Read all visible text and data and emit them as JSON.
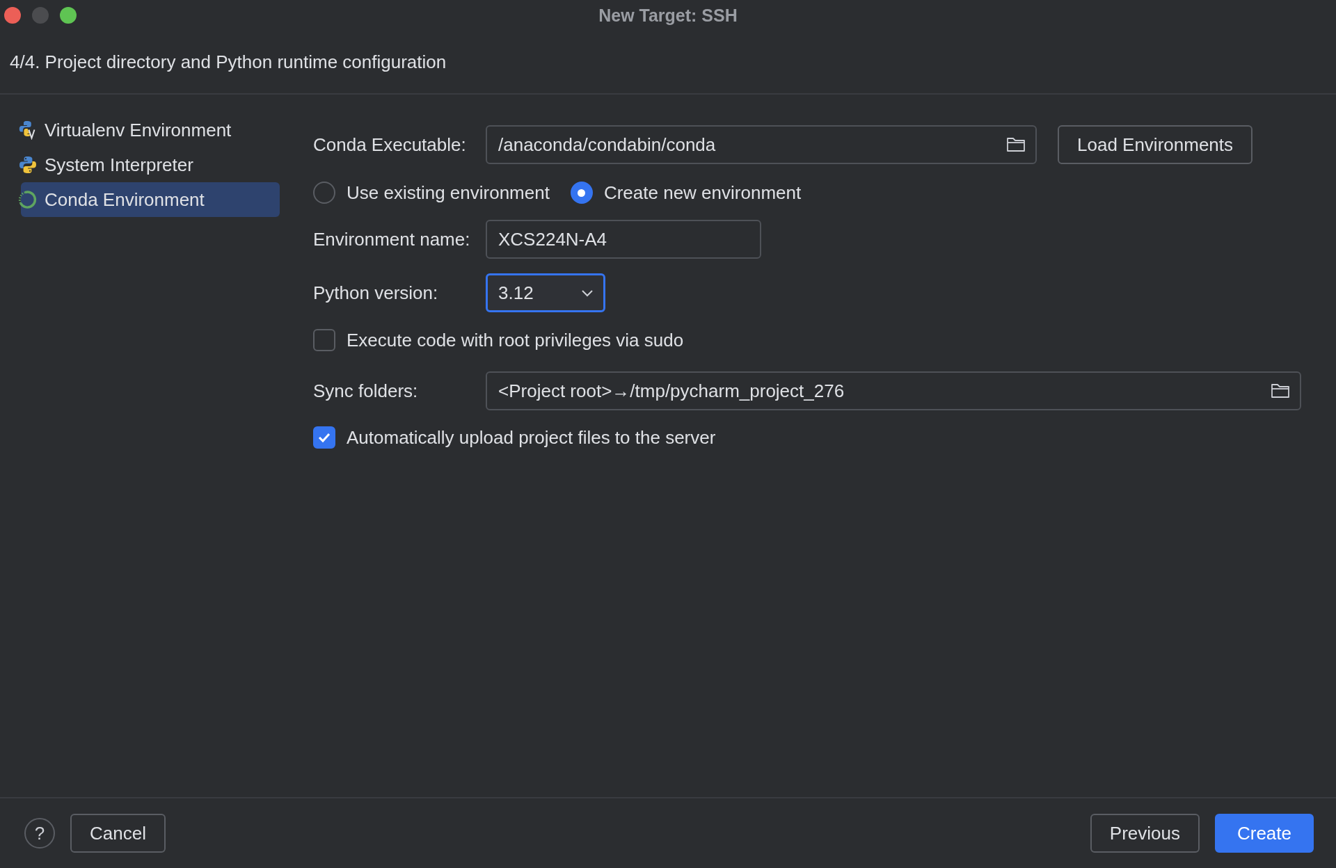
{
  "window": {
    "title": "New Target: SSH"
  },
  "step_title": "4/4. Project directory and Python runtime configuration",
  "sidebar": {
    "items": [
      {
        "label": "Virtualenv Environment",
        "kind": "virtualenv",
        "selected": false
      },
      {
        "label": "System Interpreter",
        "kind": "python",
        "selected": false
      },
      {
        "label": "Conda Environment",
        "kind": "conda",
        "selected": true
      }
    ]
  },
  "form": {
    "conda_executable": {
      "label": "Conda Executable:",
      "value": "/anaconda/condabin/conda"
    },
    "load_button": "Load Environments",
    "environment_options": [
      {
        "label": "Use existing environment",
        "selected": false
      },
      {
        "label": "Create new environment",
        "selected": true
      }
    ],
    "environment_name": {
      "label": "Environment name:",
      "value": "XCS224N-A4"
    },
    "python_version": {
      "label": "Python version:",
      "value": "3.12",
      "focused": true
    },
    "sudo": {
      "label": "Execute code with root privileges via sudo",
      "checked": false
    },
    "sync_folders": {
      "label": "Sync folders:",
      "value": "<Project root>→/tmp/pycharm_project_276"
    },
    "auto_upload": {
      "label": "Automatically upload project files to the server",
      "checked": true
    }
  },
  "footer": {
    "help": "?",
    "buttons": [
      {
        "label": "Cancel",
        "kind": "secondary"
      },
      {
        "label": "Previous",
        "kind": "secondary"
      },
      {
        "label": "Create",
        "kind": "primary"
      }
    ]
  }
}
